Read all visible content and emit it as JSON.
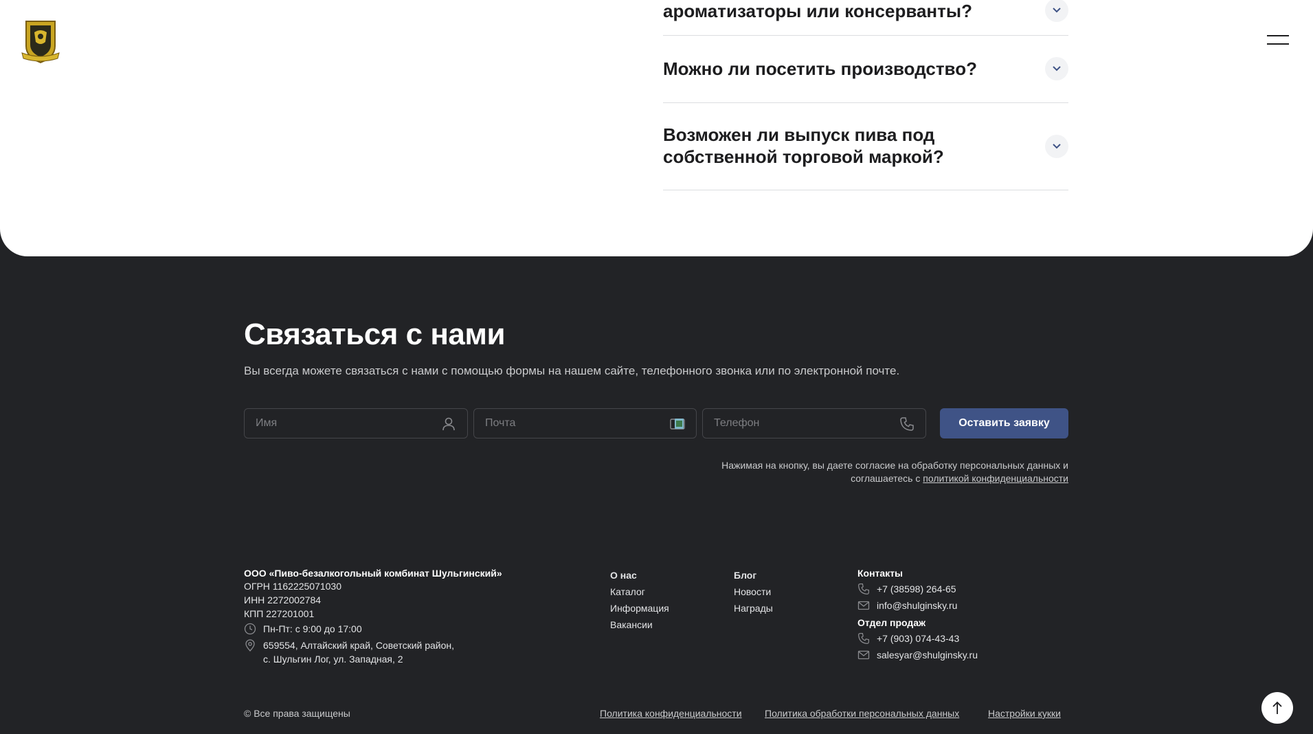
{
  "header": {
    "logo_icon": "brand-crest-logo",
    "menu_icon": "hamburger-menu-icon"
  },
  "faq": {
    "items": [
      {
        "question": "ароматизаторы или консерванты?"
      },
      {
        "question": "Можно ли посетить производство?"
      },
      {
        "question": "Возможен ли выпуск пива под собственной торговой маркой?"
      }
    ]
  },
  "contact": {
    "title": "Связаться с нами",
    "subtitle": "Вы всегда можете связаться с нами с помощью формы на нашем сайте, телефонного звонка или по электронной почте.",
    "name_placeholder": "Имя",
    "email_placeholder": "Почта",
    "phone_placeholder": "Телефон",
    "submit_label": "Оставить заявку",
    "consent_text": "Нажимая на кнопку, вы даете согласие на обработку персональных данных и соглашаетесь с",
    "consent_link": "политикой конфиденциальности"
  },
  "company": {
    "name": "ООО «Пиво-безалкогольный комбинат Шульгинский»",
    "ogrn": "ОГРН 1162225071030",
    "inn": "ИНН 2272002784",
    "kpp": "КПП 227201001",
    "hours": "Пн-Пт: с 9:00 до 17:00",
    "address_line1": "659554, Алтайский край, Советский район,",
    "address_line2": "с. Шульгин Лог, ул. Западная, 2"
  },
  "nav": {
    "col1": [
      "О нас",
      "Каталог",
      "Информация",
      "Вакансии"
    ],
    "col2": [
      "Блог",
      "Новости",
      "Награды"
    ]
  },
  "contacts": {
    "heading": "Контакты",
    "phone": "+7 (38598) 264-65",
    "email": "info@shulginsky.ru",
    "sales_heading": "Отдел продаж",
    "sales_phone": "+7 (903) 074-43-43",
    "sales_email": "salesyar@shulginsky.ru"
  },
  "footer": {
    "copyright": "© Все права защищены",
    "privacy": "Политика конфиденциальности",
    "personal_data": "Политика обработки персональных данных",
    "cookies": "Настройки кукки"
  },
  "colors": {
    "dark_bg": "#222326",
    "accent_button": "#3f5386"
  }
}
